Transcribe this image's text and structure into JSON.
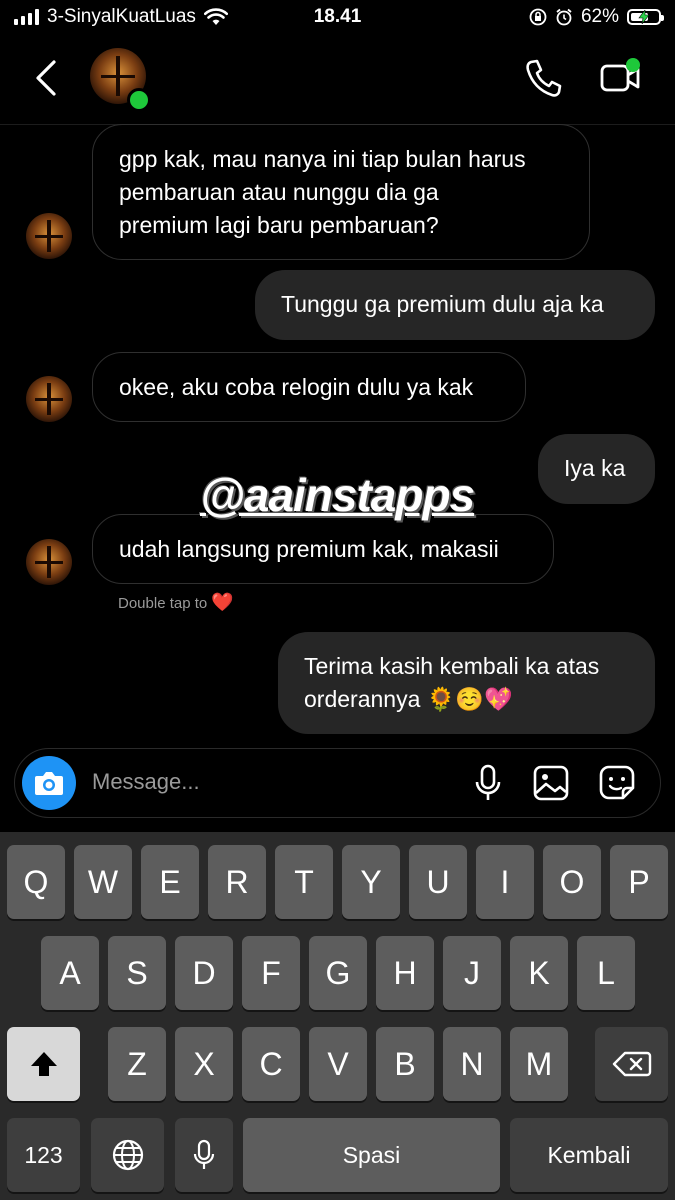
{
  "status_bar": {
    "carrier": "3-SinyalKuatLuas",
    "time": "18.41",
    "battery": "62%"
  },
  "header": {
    "back_icon": "chevron-left-icon",
    "call_icon": "phone-icon",
    "video_icon": "video-call-icon"
  },
  "messages": [
    {
      "side": "in",
      "lines": [
        "gpp kak, mau nanya ini tiap bulan harus",
        "pembaruan atau nunggu dia ga",
        "premium lagi baru pembaruan?"
      ]
    },
    {
      "side": "out",
      "lines": [
        "Tunggu ga premium dulu aja ka"
      ]
    },
    {
      "side": "in",
      "lines": [
        "okee, aku coba relogin dulu ya kak"
      ]
    },
    {
      "side": "out",
      "lines": [
        "Iya ka"
      ]
    },
    {
      "side": "in",
      "lines": [
        "udah langsung premium kak, makasii"
      ]
    },
    {
      "side": "out",
      "lines": [
        "Terima kasih kembali ka atas",
        "orderannya 🌻☺️💖"
      ]
    }
  ],
  "double_tap": {
    "text": "Double tap to",
    "heart": "❤️"
  },
  "watermark": "@aainstapps",
  "composer": {
    "placeholder": "Message...",
    "camera_icon": "camera-icon",
    "mic_icon": "microphone-icon",
    "gallery_icon": "gallery-icon",
    "sticker_icon": "sticker-icon"
  },
  "keyboard": {
    "row1": [
      "Q",
      "W",
      "E",
      "R",
      "T",
      "Y",
      "U",
      "I",
      "O",
      "P"
    ],
    "row2": [
      "A",
      "S",
      "D",
      "F",
      "G",
      "H",
      "J",
      "K",
      "L"
    ],
    "row3": [
      "Z",
      "X",
      "C",
      "V",
      "B",
      "N",
      "M"
    ],
    "numbers": "123",
    "space": "Spasi",
    "return": "Kembali"
  }
}
